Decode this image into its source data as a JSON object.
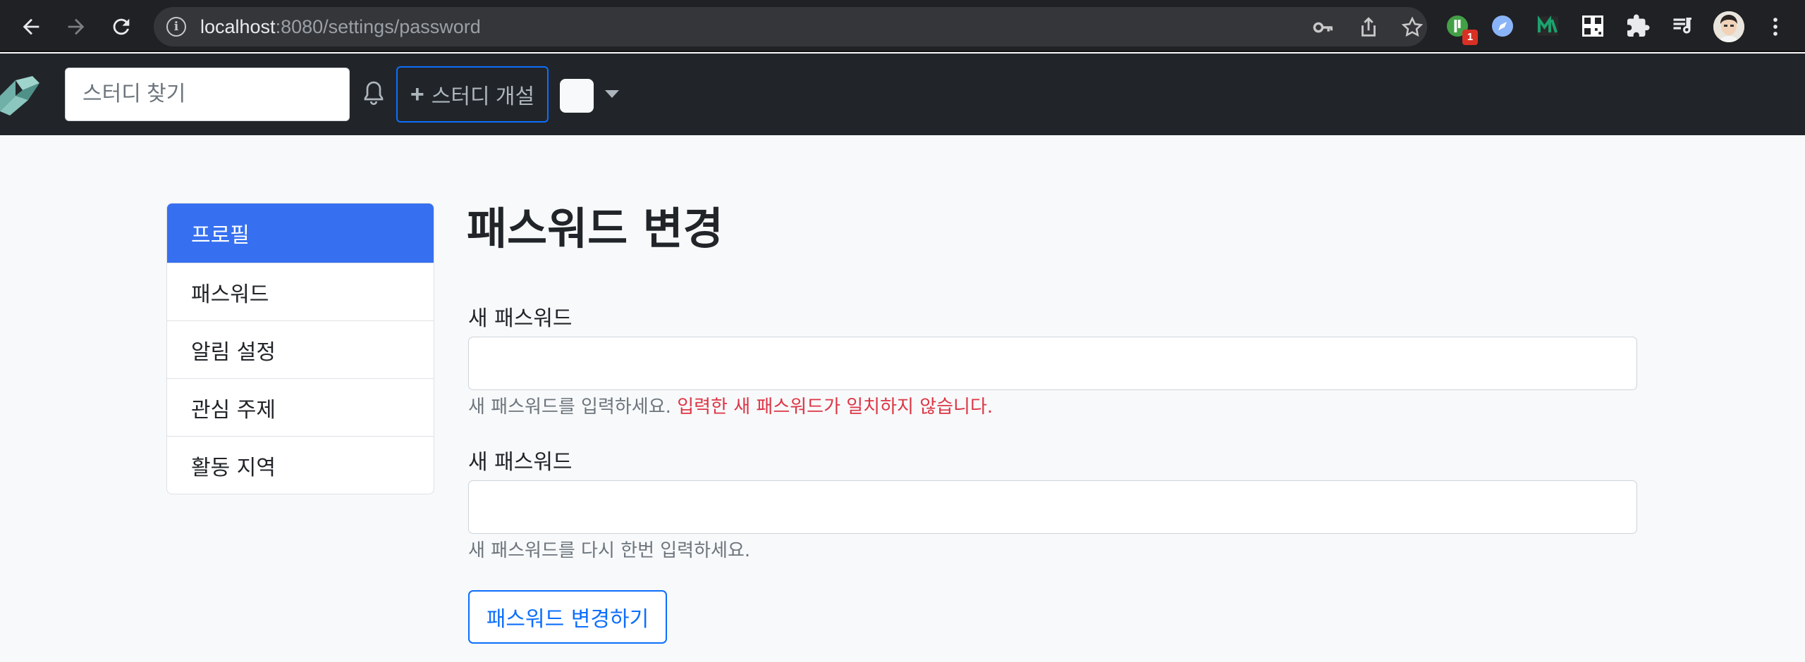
{
  "browser": {
    "url_host": "localhost",
    "url_path": ":8080/settings/password",
    "extension_badge": "1"
  },
  "navbar": {
    "search_placeholder": "스터디 찾기",
    "create_study_label": "스터디 개설",
    "create_study_icon": "+"
  },
  "sidebar": {
    "items": [
      {
        "label": "프로필",
        "active": true
      },
      {
        "label": "패스워드",
        "active": false
      },
      {
        "label": "알림 설정",
        "active": false
      },
      {
        "label": "관심 주제",
        "active": false
      },
      {
        "label": "활동 지역",
        "active": false
      }
    ]
  },
  "form": {
    "title": "패스워드 변경",
    "new_password_label": "새 패스워드",
    "new_password_help": "새 패스워드를 입력하세요.",
    "new_password_error": "입력한 새 패스워드가 일치하지 않습니다.",
    "confirm_password_label": "새 패스워드",
    "confirm_password_help": "새 패스워드를 다시 한번 입력하세요.",
    "submit_label": "패스워드 변경하기"
  },
  "colors": {
    "active_sidebar": "#3670f0",
    "primary": "#0d6efd",
    "error": "#dc3545",
    "navbar_bg": "#212529"
  }
}
